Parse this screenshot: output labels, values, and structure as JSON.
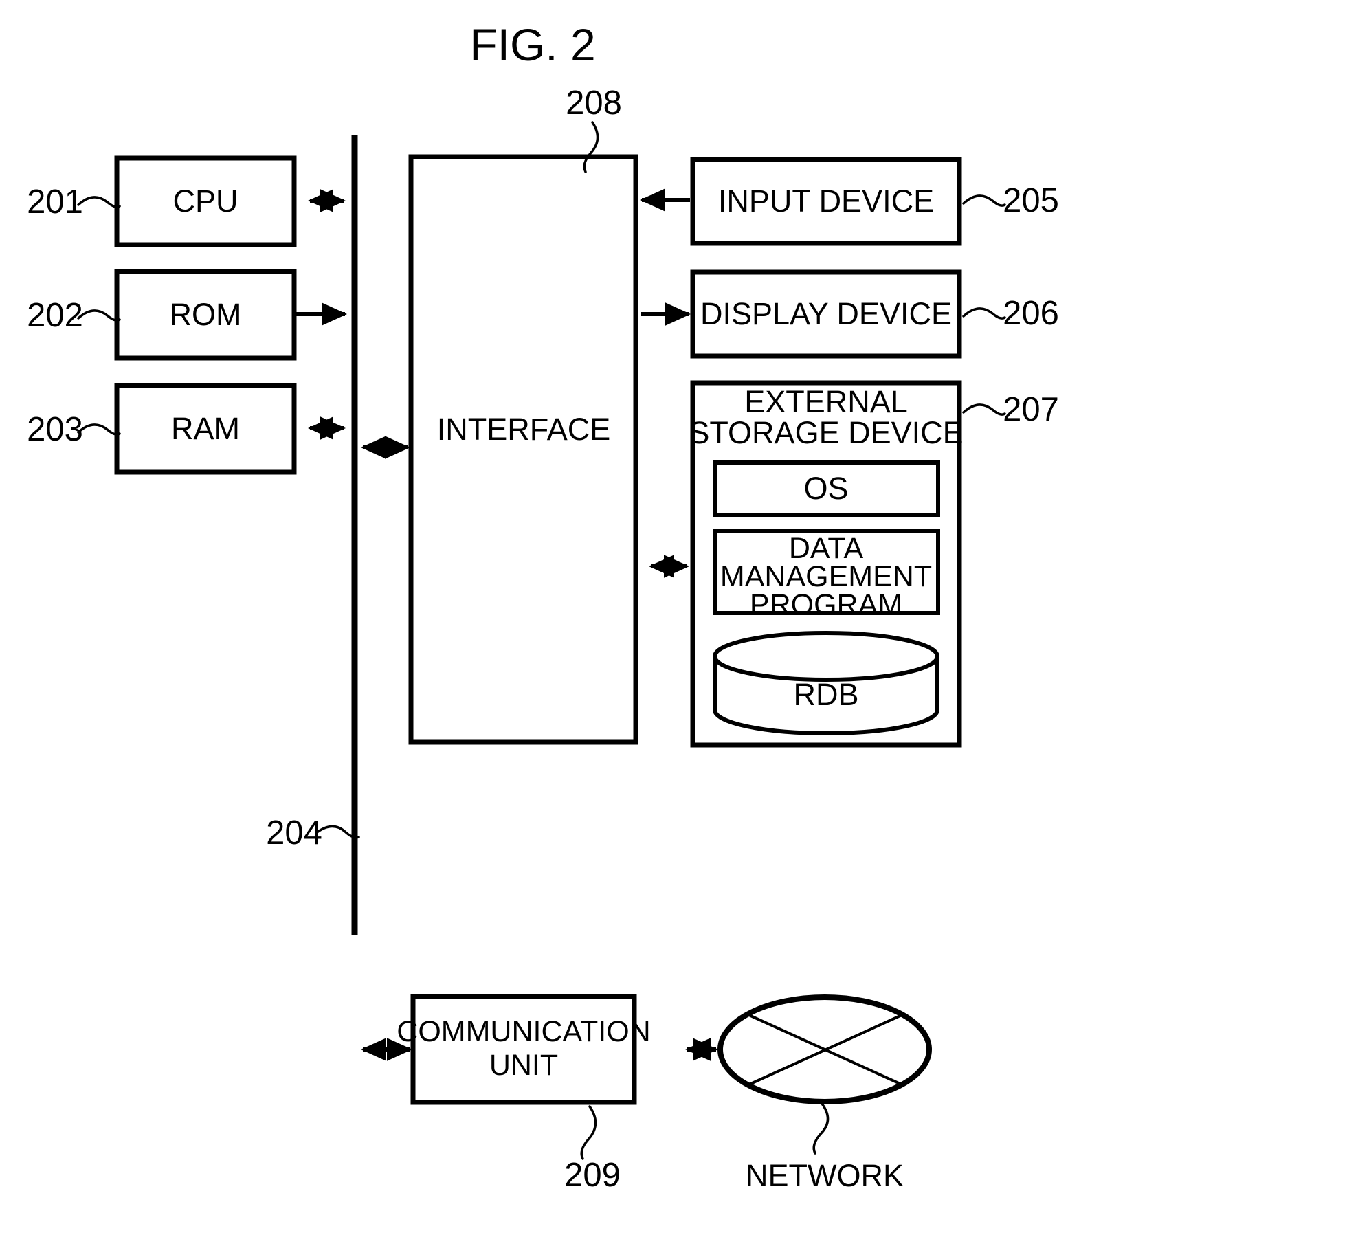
{
  "figure": {
    "title": "FIG. 2"
  },
  "blocks": {
    "cpu": {
      "label": "CPU",
      "ref": "201"
    },
    "rom": {
      "label": "ROM",
      "ref": "202"
    },
    "ram": {
      "label": "RAM",
      "ref": "203"
    },
    "bus": {
      "ref": "204"
    },
    "interface": {
      "label": "INTERFACE",
      "ref": "208"
    },
    "input_device": {
      "label": "INPUT DEVICE",
      "ref": "205"
    },
    "display_device": {
      "label": "DISPLAY DEVICE",
      "ref": "206"
    },
    "external_storage": {
      "label_line1": "EXTERNAL",
      "label_line2": "STORAGE DEVICE",
      "ref": "207",
      "children": {
        "os": {
          "label": "OS"
        },
        "data_management_program": {
          "label_line1": "DATA",
          "label_line2": "MANAGEMENT",
          "label_line3": "PROGRAM"
        },
        "rdb": {
          "label": "RDB"
        }
      }
    },
    "communication_unit": {
      "label_line1": "COMMUNICATION",
      "label_line2": "UNIT",
      "ref": "209"
    },
    "network": {
      "label": "NETWORK"
    }
  },
  "colors": {
    "ink": "#000000",
    "paper": "#ffffff"
  }
}
